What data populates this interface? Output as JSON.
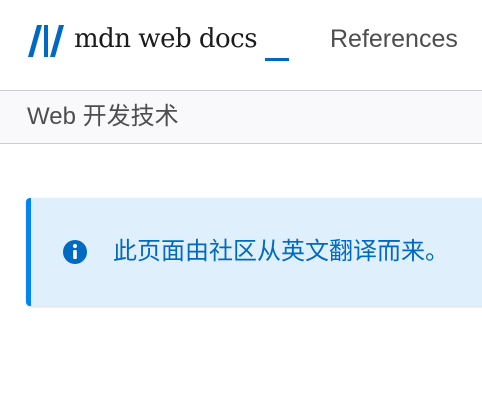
{
  "header": {
    "logo_text": "mdn web docs",
    "logo_icon": "mdn-logo-icon",
    "nav_item": "References"
  },
  "breadcrumb": {
    "label": "Web 开发技术"
  },
  "notice": {
    "icon": "info-icon",
    "message": "此页面由社区从英文翻译而来。"
  },
  "colors": {
    "accent": "#0069c2",
    "notice_bg": "#e0effc",
    "notice_border": "#0085f2",
    "breadcrumb_bg": "#f9f9fb"
  }
}
